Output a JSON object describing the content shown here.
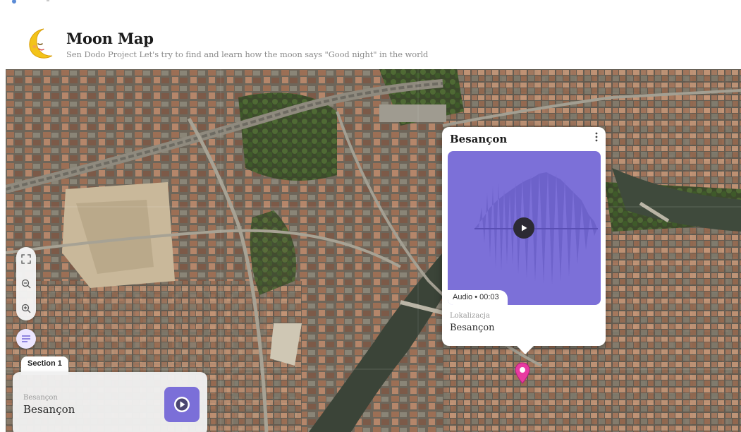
{
  "header": {
    "title": "Moon Map",
    "subtitle": "Sen Dodo Project Let's try to find and learn how the moon says \"Good night\" in the world",
    "logo_icon": "crescent-moon-face-icon"
  },
  "map": {
    "type": "satellite",
    "controls": {
      "fullscreen_icon": "fullscreen-icon",
      "zoom_out_icon": "zoom-out-icon",
      "zoom_in_icon": "zoom-in-icon",
      "menu_icon": "list-menu-icon"
    },
    "marker": {
      "icon": "map-pin-icon",
      "color": "#e83aa0"
    }
  },
  "popup": {
    "title": "Besançon",
    "menu_icon": "more-vertical-icon",
    "audio_label": "Audio • 00:03",
    "audio_color": "#7c70d8",
    "location_label": "Lokalizacja",
    "location_value": "Besançon"
  },
  "section": {
    "tab_label": "Section 1",
    "item_small": "Besançon",
    "item_big": "Besançon",
    "play_icon": "play-circle-icon",
    "play_color": "#7b6fd8"
  }
}
